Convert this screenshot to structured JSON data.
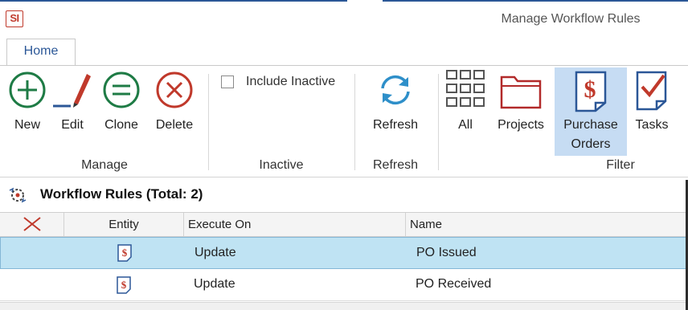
{
  "app": {
    "logo_text": "SI",
    "window_title": "Manage Workflow Rules"
  },
  "ribbon": {
    "tab": "Home",
    "manage": {
      "new_label": "New",
      "edit_label": "Edit",
      "clone_label": "Clone",
      "delete_label": "Delete",
      "group_label": "Manage"
    },
    "inactive": {
      "checkbox_label": "Include Inactive",
      "checked": false,
      "group_label": "Inactive"
    },
    "refresh": {
      "button_label": "Refresh",
      "group_label": "Refresh"
    },
    "filter": {
      "all_label": "All",
      "projects_label": "Projects",
      "purchase_orders_line1": "Purchase",
      "purchase_orders_line2": "Orders",
      "tasks_label": "Tasks",
      "group_label": "Filter",
      "active_filter": "Purchase Orders"
    }
  },
  "section": {
    "title": "Workflow Rules (Total: 2)"
  },
  "grid": {
    "columns": {
      "entity": "Entity",
      "execute_on": "Execute On",
      "name": "Name"
    },
    "rows": [
      {
        "entity_icon": "purchase-order-icon",
        "execute_on": "Update",
        "name": "PO Issued",
        "selected": true
      },
      {
        "entity_icon": "purchase-order-icon",
        "execute_on": "Update",
        "name": "PO Received",
        "selected": false
      }
    ]
  },
  "colors": {
    "accent_blue": "#2b5797",
    "icon_green": "#1e7b45",
    "icon_red": "#c0392b",
    "selected_row": "#bfe3f3",
    "active_filter_bg": "#c6dcf3"
  }
}
